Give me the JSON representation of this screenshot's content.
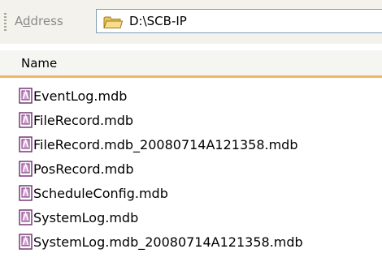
{
  "address_bar": {
    "label_prefix": "A",
    "label_access_key": "d",
    "label_suffix": "dress",
    "path": "D:\\SCB-IP",
    "icon": "folder-icon"
  },
  "file_list": {
    "column_header": "Name",
    "items": [
      {
        "name": "EventLog.mdb",
        "icon": "access-database-icon"
      },
      {
        "name": "FileRecord.mdb",
        "icon": "access-database-icon"
      },
      {
        "name": "FileRecord.mdb_20080714A121358.mdb",
        "icon": "access-database-icon"
      },
      {
        "name": "PosRecord.mdb",
        "icon": "access-database-icon"
      },
      {
        "name": "ScheduleConfig.mdb",
        "icon": "access-database-icon"
      },
      {
        "name": "SystemLog.mdb",
        "icon": "access-database-icon"
      },
      {
        "name": "SystemLog.mdb_20080714A121358.mdb",
        "icon": "access-database-icon"
      }
    ]
  },
  "colors": {
    "header_underline": "#f3b563",
    "toolbar_background": "#f3f2ec",
    "address_border": "#7f9db9"
  }
}
